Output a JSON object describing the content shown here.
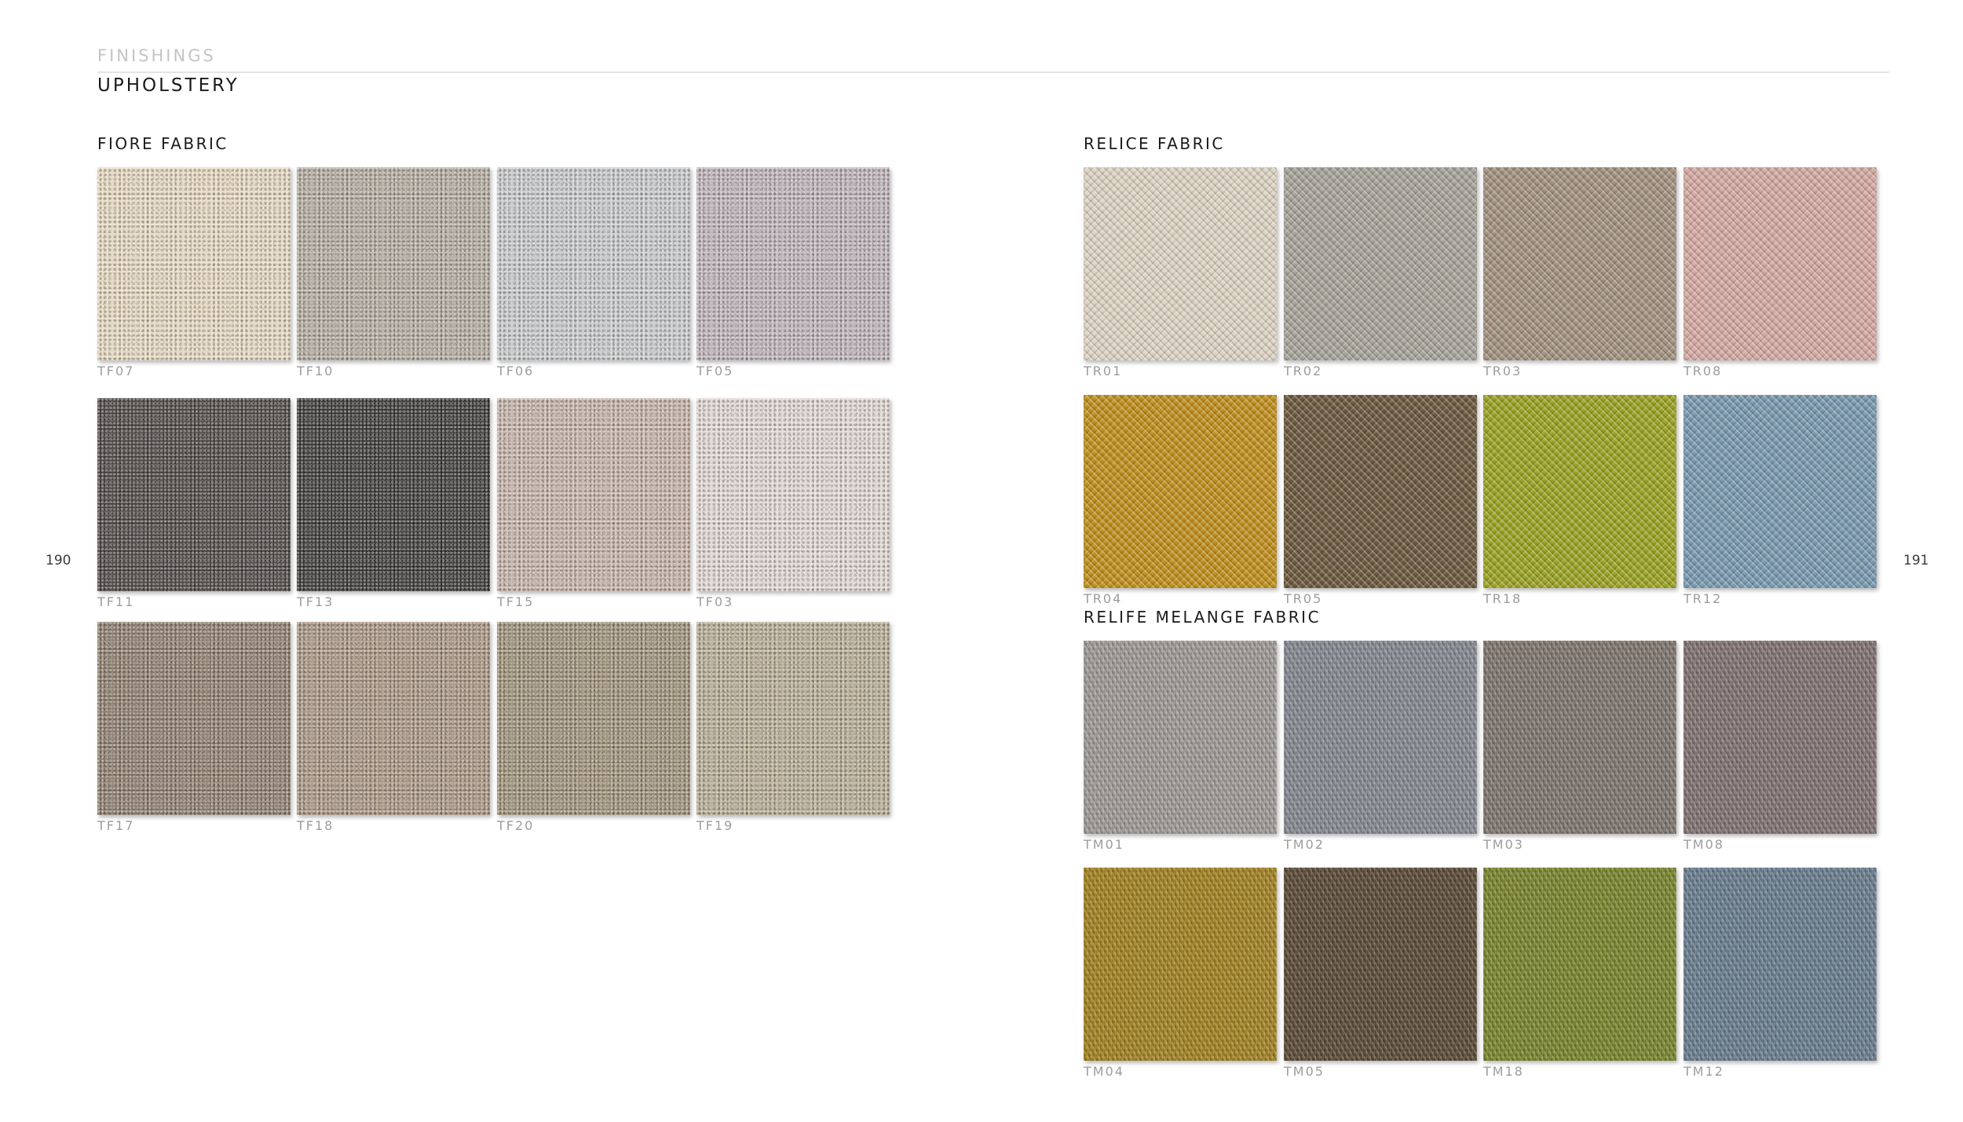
{
  "header": {
    "section": "FINISHINGS",
    "title": "UPHOLSTERY"
  },
  "pages": {
    "left": "190",
    "right": "191"
  },
  "groups": [
    {
      "title": "FIORE FABRIC",
      "texture": "boucle",
      "rows": [
        [
          {
            "code": "TF07",
            "color": "#e6d8c0"
          },
          {
            "code": "TF10",
            "color": "#b5aca0"
          },
          {
            "code": "TF06",
            "color": "#c8cacc"
          },
          {
            "code": "TF05",
            "color": "#bfb3ba"
          }
        ],
        [
          {
            "code": "TF11",
            "color": "#4a4644"
          },
          {
            "code": "TF13",
            "color": "#3a3837"
          },
          {
            "code": "TF15",
            "color": "#c7b3a9"
          },
          {
            "code": "TF03",
            "color": "#e2d7d1"
          }
        ],
        [
          {
            "code": "TF17",
            "color": "#8e7d6d"
          },
          {
            "code": "TF18",
            "color": "#a99583"
          },
          {
            "code": "TF20",
            "color": "#9e9178"
          },
          {
            "code": "TF19",
            "color": "#b8ad94"
          }
        ]
      ]
    },
    {
      "title": "RELICE FABRIC",
      "texture": "weave",
      "rows": [
        [
          {
            "code": "TR01",
            "color": "#ddd3c3"
          },
          {
            "code": "TR02",
            "color": "#a7a49a"
          },
          {
            "code": "TR03",
            "color": "#a39280"
          },
          {
            "code": "TR08",
            "color": "#d4aaa3"
          }
        ],
        [
          {
            "code": "TR04",
            "color": "#bf901f"
          },
          {
            "code": "TR05",
            "color": "#6c5a40"
          },
          {
            "code": "TR18",
            "color": "#9ba325"
          },
          {
            "code": "TR12",
            "color": "#7b9ab0"
          }
        ]
      ]
    },
    {
      "title": "RELIFE MELANGE FABRIC",
      "texture": "melange",
      "rows": [
        [
          {
            "code": "TM01",
            "color": "#a49f9b"
          },
          {
            "code": "TM02",
            "color": "#8a8d96"
          },
          {
            "code": "TM03",
            "color": "#847a72"
          },
          {
            "code": "TM08",
            "color": "#857775"
          }
        ],
        [
          {
            "code": "TM04",
            "color": "#a88725"
          },
          {
            "code": "TM05",
            "color": "#5e4e39"
          },
          {
            "code": "TM18",
            "color": "#7e8a30"
          },
          {
            "code": "TM12",
            "color": "#6e8293"
          }
        ]
      ]
    }
  ]
}
